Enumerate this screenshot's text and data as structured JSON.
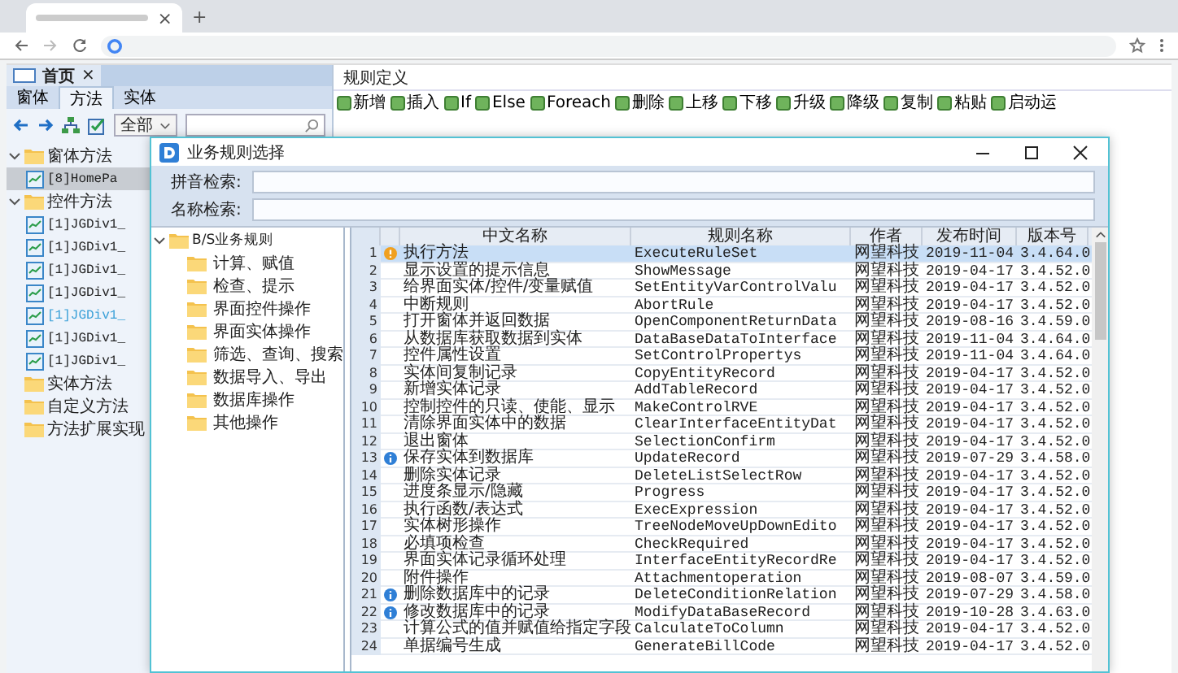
{
  "browser": {
    "tab": {
      "close": "×"
    },
    "new_tab": "+"
  },
  "page_tab": {
    "label": "首页",
    "close": "×"
  },
  "nav_tabs": [
    {
      "label": "窗体",
      "selected": false
    },
    {
      "label": "方法",
      "selected": true
    },
    {
      "label": "实体",
      "selected": false
    }
  ],
  "filter": {
    "value": "全部"
  },
  "tree": [
    {
      "label": "窗体方法",
      "expanded": true,
      "children": [
        {
          "label": "[8]HomePa",
          "selected": true,
          "highlighted": false
        }
      ]
    },
    {
      "label": "控件方法",
      "expanded": true,
      "children": [
        {
          "label": "[1]JGDiv1_",
          "selected": false,
          "highlighted": false
        },
        {
          "label": "[1]JGDiv1_",
          "selected": false,
          "highlighted": false
        },
        {
          "label": "[1]JGDiv1_",
          "selected": false,
          "highlighted": false
        },
        {
          "label": "[1]JGDiv1_",
          "selected": false,
          "highlighted": false
        },
        {
          "label": "[1]JGDiv1_",
          "selected": false,
          "highlighted": true
        },
        {
          "label": "[1]JGDiv1_",
          "selected": false,
          "highlighted": false
        },
        {
          "label": "[1]JGDiv1_",
          "selected": false,
          "highlighted": false
        }
      ]
    },
    {
      "label": "实体方法",
      "expanded": false
    },
    {
      "label": "自定义方法",
      "expanded": false
    },
    {
      "label": "方法扩展实现",
      "expanded": false
    }
  ],
  "rule_panel": {
    "title": "规则定义",
    "toolbar": [
      "新增",
      "插入",
      "If",
      "Else",
      "Foreach",
      "删除",
      "上移",
      "下移",
      "升级",
      "降级",
      "复制",
      "粘贴",
      "启动运"
    ]
  },
  "dialog": {
    "title": "业务规则选择",
    "fields": [
      {
        "label": "拼音检索:"
      },
      {
        "label": "名称检索:"
      }
    ],
    "tree": {
      "label": "B/S业务规则",
      "expanded": true,
      "children": [
        {
          "label": "计算、赋值"
        },
        {
          "label": "检查、提示"
        },
        {
          "label": "界面控件操作"
        },
        {
          "label": "界面实体操作"
        },
        {
          "label": "筛选、查询、搜索"
        },
        {
          "label": "数据导入、导出"
        },
        {
          "label": "数据库操作"
        },
        {
          "label": "其他操作"
        }
      ]
    },
    "table": {
      "columns": [
        "中文名称",
        "规则名称",
        "作者",
        "发布时间",
        "版本号"
      ],
      "rows": [
        {
          "num": "1",
          "kind": "warning",
          "name": "执行方法",
          "rule": "ExecuteRuleSet",
          "author": "网望科技",
          "date": "2019-11-04",
          "version": "3.4.64.0",
          "selected": true
        },
        {
          "num": "2",
          "name": "显示设置的提示信息",
          "rule": "ShowMessage",
          "author": "网望科技",
          "date": "2019-04-17",
          "version": "3.4.52.0",
          "selected": false
        },
        {
          "num": "3",
          "name": "给界面实体/控件/变量赋值",
          "rule": "SetEntityVarControlValu",
          "author": "网望科技",
          "date": "2019-04-17",
          "version": "3.4.52.0",
          "selected": false
        },
        {
          "num": "4",
          "name": "中断规则",
          "rule": "AbortRule",
          "author": "网望科技",
          "date": "2019-04-17",
          "version": "3.4.52.0",
          "selected": false
        },
        {
          "num": "5",
          "name": "打开窗体并返回数据",
          "rule": "OpenComponentReturnData",
          "author": "网望科技",
          "date": "2019-08-16",
          "version": "3.4.59.0",
          "selected": false
        },
        {
          "num": "6",
          "name": "从数据库获取数据到实体",
          "rule": "DataBaseDataToInterface",
          "author": "网望科技",
          "date": "2019-11-04",
          "version": "3.4.64.0",
          "selected": false
        },
        {
          "num": "7",
          "name": "控件属性设置",
          "rule": "SetControlPropertys",
          "author": "网望科技",
          "date": "2019-11-04",
          "version": "3.4.64.0",
          "selected": false
        },
        {
          "num": "8",
          "name": "实体间复制记录",
          "rule": "CopyEntityRecord",
          "author": "网望科技",
          "date": "2019-04-17",
          "version": "3.4.52.0",
          "selected": false
        },
        {
          "num": "9",
          "name": "新增实体记录",
          "rule": "AddTableRecord",
          "author": "网望科技",
          "date": "2019-04-17",
          "version": "3.4.52.0",
          "selected": false
        },
        {
          "num": "10",
          "name": "控制控件的只读、使能、显示",
          "rule": "MakeControlRVE",
          "author": "网望科技",
          "date": "2019-04-17",
          "version": "3.4.52.0",
          "selected": false
        },
        {
          "num": "11",
          "name": "清除界面实体中的数据",
          "rule": "ClearInterfaceEntityDat",
          "author": "网望科技",
          "date": "2019-04-17",
          "version": "3.4.52.0",
          "selected": false
        },
        {
          "num": "12",
          "name": "退出窗体",
          "rule": "SelectionConfirm",
          "author": "网望科技",
          "date": "2019-04-17",
          "version": "3.4.52.0",
          "selected": false
        },
        {
          "num": "13",
          "kind": "info",
          "name": "保存实体到数据库",
          "rule": "UpdateRecord",
          "author": "网望科技",
          "date": "2019-07-29",
          "version": "3.4.58.0",
          "selected": false
        },
        {
          "num": "14",
          "name": "删除实体记录",
          "rule": "DeleteListSelectRow",
          "author": "网望科技",
          "date": "2019-04-17",
          "version": "3.4.52.0",
          "selected": false
        },
        {
          "num": "15",
          "name": "进度条显示/隐藏",
          "rule": "Progress",
          "author": "网望科技",
          "date": "2019-04-17",
          "version": "3.4.52.0",
          "selected": false
        },
        {
          "num": "16",
          "name": "执行函数/表达式",
          "rule": "ExecExpression",
          "author": "网望科技",
          "date": "2019-04-17",
          "version": "3.4.52.0",
          "selected": false
        },
        {
          "num": "17",
          "name": "实体树形操作",
          "rule": "TreeNodeMoveUpDownEdito",
          "author": "网望科技",
          "date": "2019-04-17",
          "version": "3.4.52.0",
          "selected": false
        },
        {
          "num": "18",
          "name": "必填项检查",
          "rule": "CheckRequired",
          "author": "网望科技",
          "date": "2019-04-17",
          "version": "3.4.52.0",
          "selected": false
        },
        {
          "num": "19",
          "name": "界面实体记录循环处理",
          "rule": "InterfaceEntityRecordRe",
          "author": "网望科技",
          "date": "2019-04-17",
          "version": "3.4.52.0",
          "selected": false
        },
        {
          "num": "20",
          "name": "附件操作",
          "rule": "Attachmentoperation",
          "author": "网望科技",
          "date": "2019-08-07",
          "version": "3.4.59.0",
          "selected": false
        },
        {
          "num": "21",
          "kind": "info",
          "name": "删除数据库中的记录",
          "rule": "DeleteConditionRelation",
          "author": "网望科技",
          "date": "2019-07-29",
          "version": "3.4.58.0",
          "selected": false
        },
        {
          "num": "22",
          "kind": "info",
          "name": "修改数据库中的记录",
          "rule": "ModifyDataBaseRecord",
          "author": "网望科技",
          "date": "2019-10-28",
          "version": "3.4.63.0",
          "selected": false
        },
        {
          "num": "23",
          "name": "计算公式的值并赋值给指定字段",
          "rule": "CalculateToColumn",
          "author": "网望科技",
          "date": "2019-04-17",
          "version": "3.4.52.0",
          "selected": false
        },
        {
          "num": "24",
          "name": "单据编号生成",
          "rule": "GenerateBillCode",
          "author": "网望科技",
          "date": "2019-04-17",
          "version": "3.4.52.0",
          "selected": false
        }
      ]
    }
  }
}
